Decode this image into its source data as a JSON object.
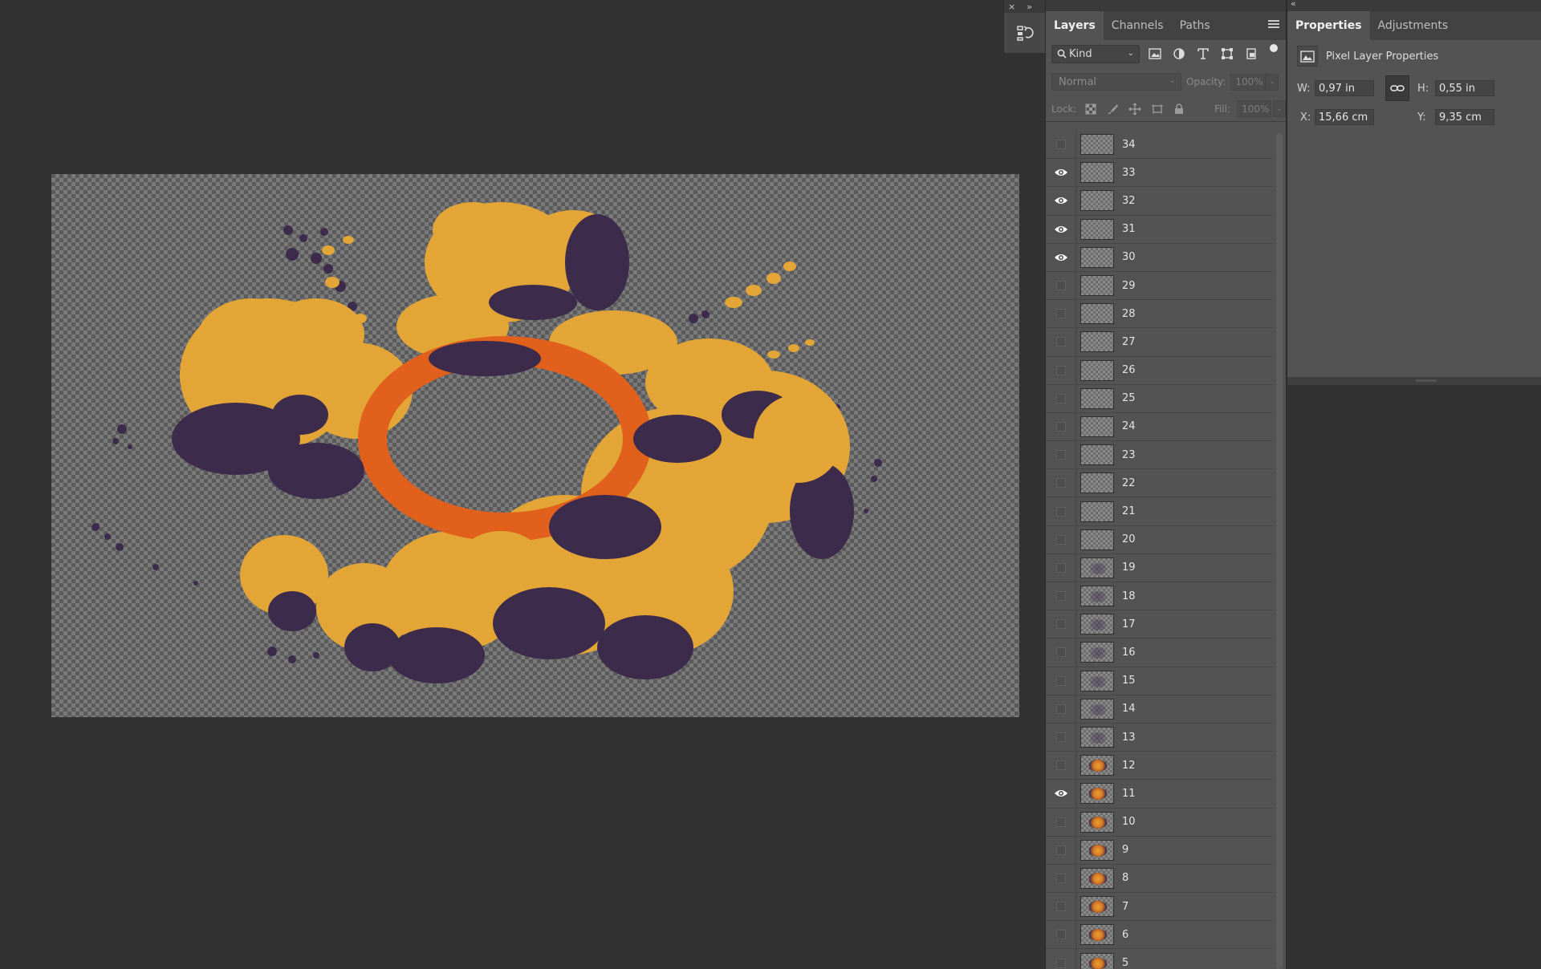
{
  "mini_strip": {
    "close_glyph": "×",
    "expand_glyph": "»"
  },
  "layers_panel": {
    "collapse_glyph": "«",
    "tabs": [
      {
        "label": "Layers",
        "active": true
      },
      {
        "label": "Channels",
        "active": false
      },
      {
        "label": "Paths",
        "active": false
      }
    ],
    "filter_kind": "Kind",
    "blend_mode": "Normal",
    "opacity_label": "Opacity:",
    "opacity_value": "100%",
    "lock_label": "Lock:",
    "fill_label": "Fill:",
    "fill_value": "100%",
    "layers": [
      {
        "name": "34",
        "visible": false,
        "thumb": "empty"
      },
      {
        "name": "33",
        "visible": true,
        "thumb": "empty"
      },
      {
        "name": "32",
        "visible": true,
        "thumb": "empty"
      },
      {
        "name": "31",
        "visible": true,
        "thumb": "empty"
      },
      {
        "name": "30",
        "visible": true,
        "thumb": "empty"
      },
      {
        "name": "29",
        "visible": false,
        "thumb": "empty"
      },
      {
        "name": "28",
        "visible": false,
        "thumb": "empty"
      },
      {
        "name": "27",
        "visible": false,
        "thumb": "empty"
      },
      {
        "name": "26",
        "visible": false,
        "thumb": "empty"
      },
      {
        "name": "25",
        "visible": false,
        "thumb": "empty"
      },
      {
        "name": "24",
        "visible": false,
        "thumb": "empty"
      },
      {
        "name": "23",
        "visible": false,
        "thumb": "empty"
      },
      {
        "name": "22",
        "visible": false,
        "thumb": "empty"
      },
      {
        "name": "21",
        "visible": false,
        "thumb": "empty"
      },
      {
        "name": "20",
        "visible": false,
        "thumb": "empty"
      },
      {
        "name": "19",
        "visible": false,
        "thumb": "faint"
      },
      {
        "name": "18",
        "visible": false,
        "thumb": "faint"
      },
      {
        "name": "17",
        "visible": false,
        "thumb": "faint"
      },
      {
        "name": "16",
        "visible": false,
        "thumb": "faint"
      },
      {
        "name": "15",
        "visible": false,
        "thumb": "faint"
      },
      {
        "name": "14",
        "visible": false,
        "thumb": "faint"
      },
      {
        "name": "13",
        "visible": false,
        "thumb": "faint"
      },
      {
        "name": "12",
        "visible": false,
        "thumb": "explosion"
      },
      {
        "name": "11",
        "visible": true,
        "thumb": "explosion"
      },
      {
        "name": "10",
        "visible": false,
        "thumb": "explosion"
      },
      {
        "name": "9",
        "visible": false,
        "thumb": "explosion"
      },
      {
        "name": "8",
        "visible": false,
        "thumb": "explosion"
      },
      {
        "name": "7",
        "visible": false,
        "thumb": "explosion"
      },
      {
        "name": "6",
        "visible": false,
        "thumb": "explosion"
      },
      {
        "name": "5",
        "visible": false,
        "thumb": "explosion"
      }
    ]
  },
  "properties_panel": {
    "collapse_glyph": "«",
    "tabs": [
      {
        "label": "Properties",
        "active": true
      },
      {
        "label": "Adjustments",
        "active": false
      }
    ],
    "section_title": "Pixel Layer Properties",
    "w_label": "W:",
    "w_value": "0,97 in",
    "h_label": "H:",
    "h_value": "0,55 in",
    "x_label": "X:",
    "x_value": "15,66 cm",
    "y_label": "Y:",
    "y_value": "9,35 cm"
  },
  "colors": {
    "explosion_yellow": "#e3a535",
    "explosion_orange": "#e0601c",
    "explosion_purple": "#3d2b4c",
    "workspace": "#323232",
    "panel": "#535353"
  }
}
